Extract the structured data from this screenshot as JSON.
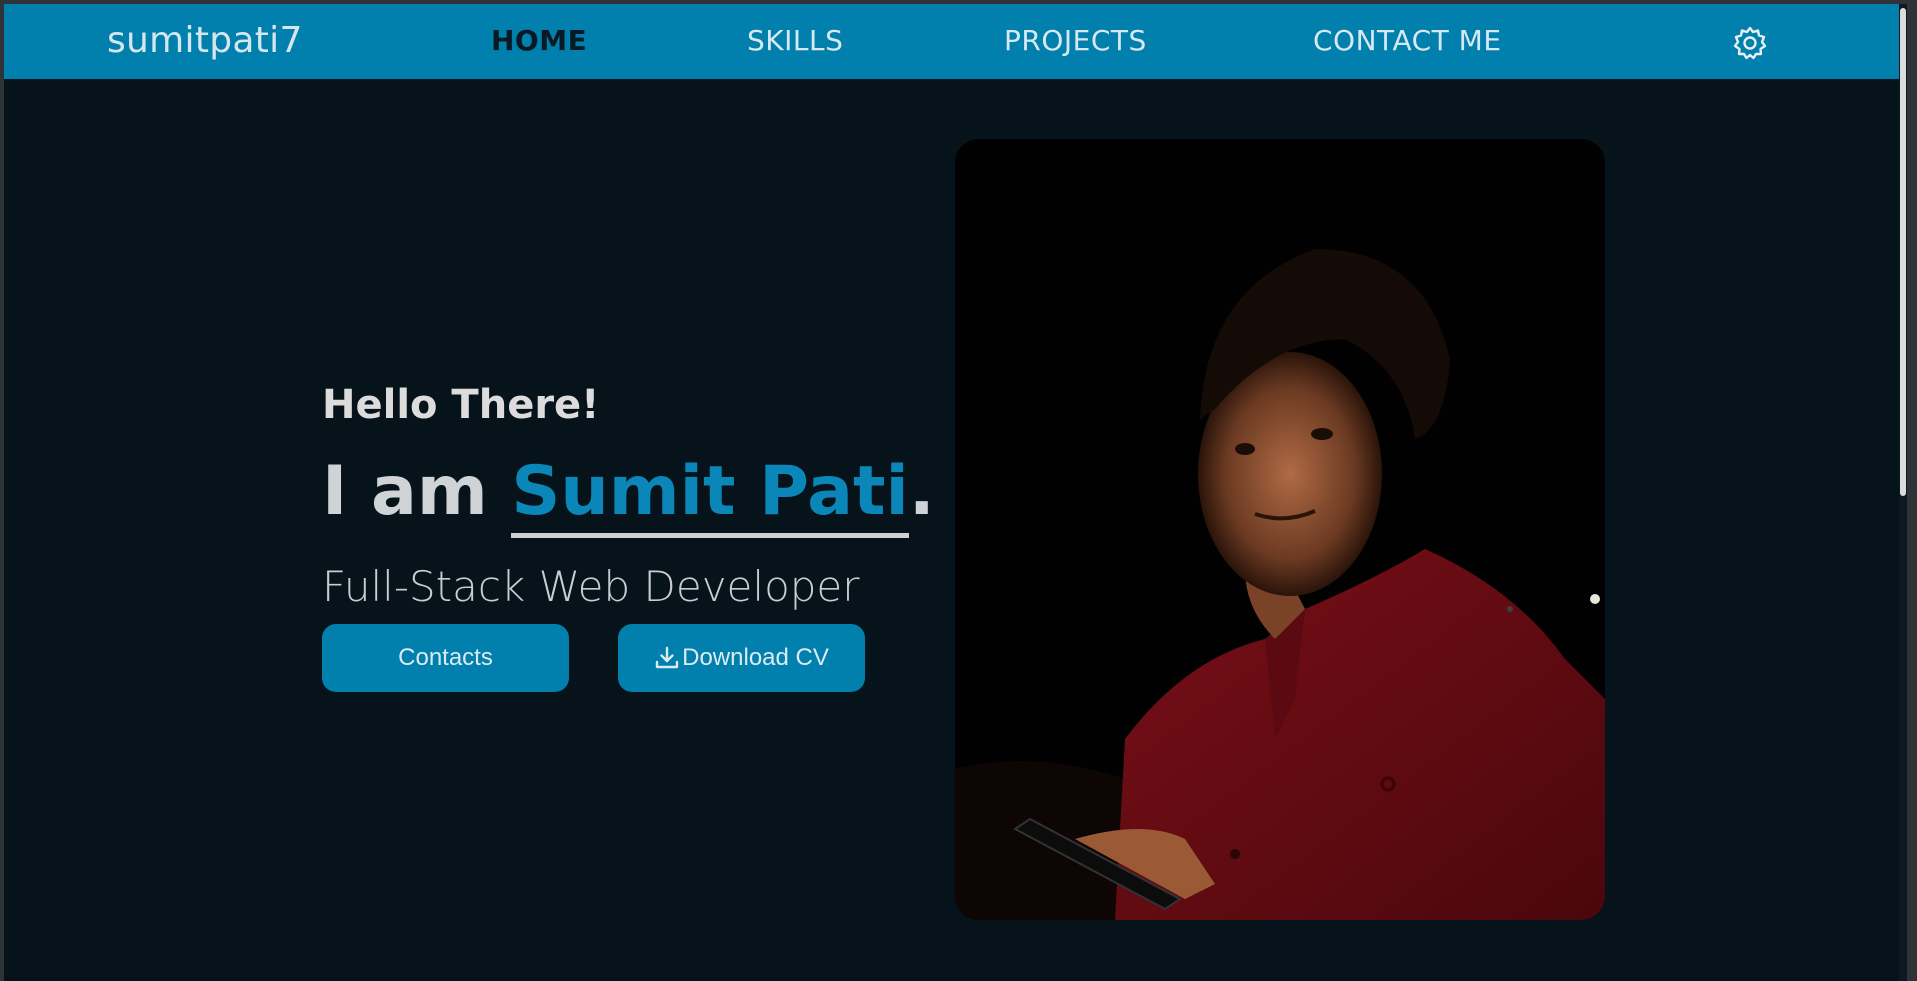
{
  "nav": {
    "brand": "sumitpati7",
    "links": [
      {
        "label": "HOME",
        "active": true
      },
      {
        "label": "SKILLS",
        "active": false
      },
      {
        "label": "PROJECTS",
        "active": false
      },
      {
        "label": "CONTACT ME",
        "active": false
      }
    ],
    "settings_icon": "gear-icon"
  },
  "hero": {
    "greeting": "Hello There!",
    "intro_prefix": "I am ",
    "name": "Sumit Pati",
    "intro_suffix": ".",
    "role": "Full-Stack Web Developer",
    "buttons": {
      "contacts": "Contacts",
      "download_cv": "Download CV"
    },
    "download_icon": "download-icon",
    "photo_alt": "portrait-photo"
  },
  "colors": {
    "accent": "#017fad",
    "background": "#06131b",
    "name_highlight": "#0b86b8"
  }
}
